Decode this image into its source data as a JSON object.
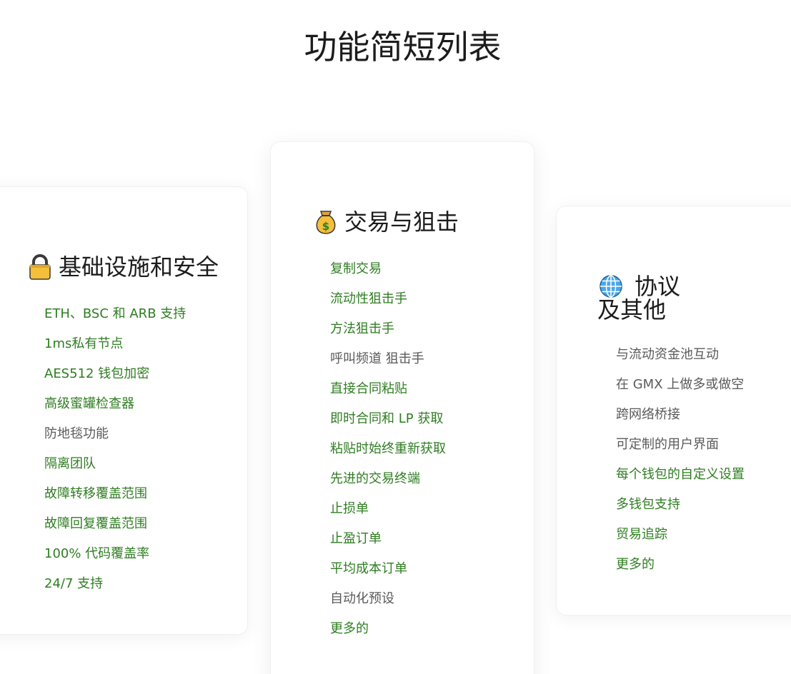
{
  "page": {
    "title": "功能简短列表"
  },
  "cards": [
    {
      "icon": "lock-icon",
      "heading": "基础设施和安全",
      "items": [
        {
          "label": "ETH、BSC 和 ARB 支持",
          "color": "#2f7d22"
        },
        {
          "label": "1ms私有节点",
          "color": "#2f7d22"
        },
        {
          "label": "AES512 钱包加密",
          "color": "#2f7d22"
        },
        {
          "label": "高级蜜罐检查器",
          "color": "#2f7d22"
        },
        {
          "label": "防地毯功能",
          "color": "#5a5a5a"
        },
        {
          "label": "隔离团队",
          "color": "#2f7d22"
        },
        {
          "label": "故障转移覆盖范围",
          "color": "#2f7d22"
        },
        {
          "label": "故障回复覆盖范围",
          "color": "#2f7d22"
        },
        {
          "label": "100% 代码覆盖率",
          "color": "#2f7d22"
        },
        {
          "label": "24/7 支持",
          "color": "#2f7d22"
        }
      ]
    },
    {
      "icon": "money-bag-icon",
      "heading": "交易与狙击",
      "items": [
        {
          "label": "复制交易",
          "color": "#2f7d22"
        },
        {
          "label": "流动性狙击手",
          "color": "#2f7d22"
        },
        {
          "label": "方法狙击手",
          "color": "#2f7d22"
        },
        {
          "label": "呼叫频道 狙击手",
          "color": "#5a5a5a"
        },
        {
          "label": "直接合同粘贴",
          "color": "#2f7d22"
        },
        {
          "label": "即时合同和 LP 获取",
          "color": "#2f7d22"
        },
        {
          "label": "粘贴时始终重新获取",
          "color": "#2f7d22"
        },
        {
          "label": "先进的交易终端",
          "color": "#2f7d22"
        },
        {
          "label": "止损单",
          "color": "#2f7d22"
        },
        {
          "label": "止盈订单",
          "color": "#2f7d22"
        },
        {
          "label": "平均成本订单",
          "color": "#2f7d22"
        },
        {
          "label": "自动化预设",
          "color": "#5a5a5a"
        },
        {
          "label": "更多的",
          "color": "#2f7d22"
        }
      ]
    },
    {
      "icon": "globe-icon",
      "heading_line1": "协议",
      "heading_line2": "及其他",
      "items": [
        {
          "label": "与流动资金池互动",
          "color": "#5a5a5a"
        },
        {
          "label": "在 GMX 上做多或做空",
          "color": "#5a5a5a"
        },
        {
          "label": "跨网络桥接",
          "color": "#5a5a5a"
        },
        {
          "label": "可定制的用户界面",
          "color": "#5a5a5a"
        },
        {
          "label": "每个钱包的自定义设置",
          "color": "#2f7d22"
        },
        {
          "label": "多钱包支持",
          "color": "#2f7d22"
        },
        {
          "label": "贸易追踪",
          "color": "#2f7d22"
        },
        {
          "label": "更多的",
          "color": "#2f7d22"
        }
      ]
    }
  ]
}
